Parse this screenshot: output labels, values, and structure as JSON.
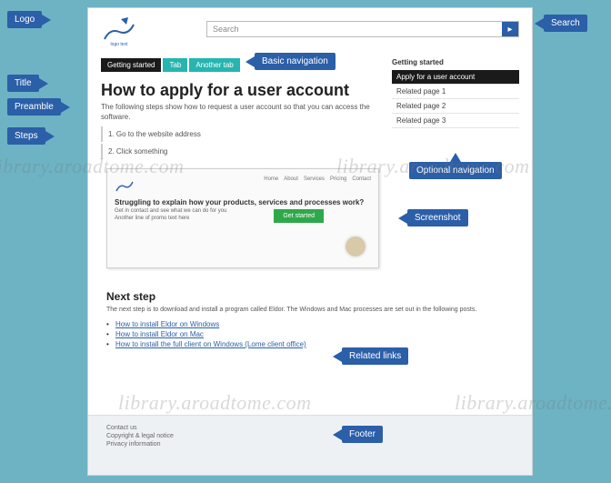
{
  "callouts": {
    "logo": "Logo",
    "search": "Search",
    "title": "Title",
    "preamble": "Preamble",
    "steps": "Steps",
    "basicnav": "Basic navigation",
    "optnav": "Optional navigation",
    "screenshot": "Screenshot",
    "related": "Related links",
    "footer": "Footer"
  },
  "search": {
    "placeholder": "Search",
    "button": "▸"
  },
  "nav": {
    "tab0": "Getting started",
    "tab1": "Tab",
    "tab2": "Another tab"
  },
  "page": {
    "title": "How to apply for a user account",
    "preamble": "The following steps show how to request a user account so that you can access the software.",
    "step1": "1. Go to the website address",
    "step2": "2. Click something"
  },
  "sidebar": {
    "heading": "Getting started",
    "items": [
      "Apply for a user account",
      "Related page 1",
      "Related page 2",
      "Related page 3"
    ]
  },
  "shot": {
    "navitems": [
      "Home",
      "About",
      "Services",
      "Pricing",
      "Contact"
    ],
    "title": "Struggling to explain how your products, services and processes work?",
    "txt1": "Get in contact and see what we can do for you",
    "txt2": "Another line of promo text here",
    "btn": "Get started"
  },
  "next": {
    "heading": "Next step",
    "para": "The next step is to download and install a program called Eldor. The Windows and Mac processes are set out in the following posts.",
    "links": [
      "How to install Eldor on Windows",
      "How to install Eldor on Mac",
      "How to install the full client on Windows (Lome client office)"
    ]
  },
  "footer": {
    "l1": "Contact us",
    "l2": "Copyright & legal notice",
    "l3": "Privacy information"
  },
  "watermark": "library.aroadtome.com"
}
